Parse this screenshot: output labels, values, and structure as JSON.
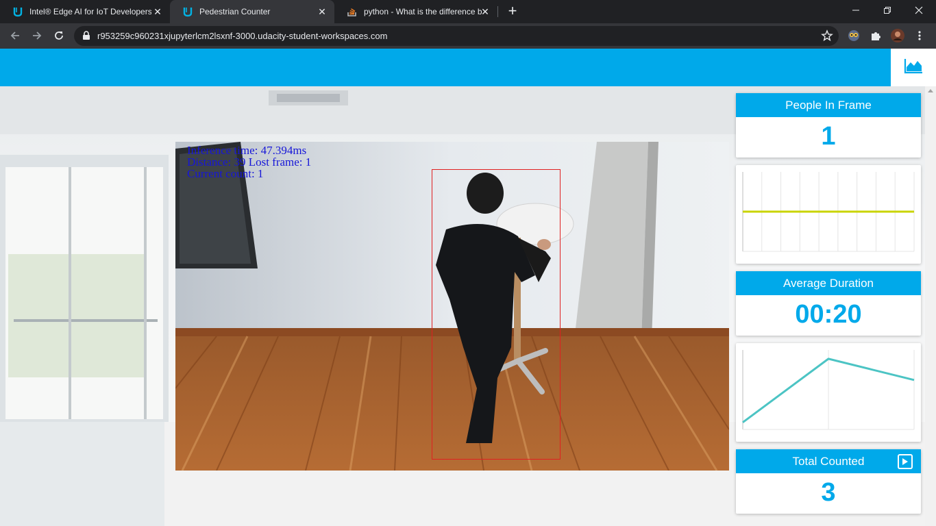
{
  "browser": {
    "tabs": [
      {
        "title": "Intel® Edge AI for IoT Developers",
        "icon": "udacity-icon",
        "active": false
      },
      {
        "title": "Pedestrian Counter",
        "icon": "udacity-icon",
        "active": true
      },
      {
        "title": "python - What is the difference b",
        "icon": "stackoverflow-icon",
        "active": false
      }
    ],
    "new_tab_label": "+",
    "url": "r953259c960231xjupyterlcm2lsxnf-3000.udacity-student-workspaces.com",
    "window_controls": [
      "minimize-icon",
      "restore-icon",
      "close-icon"
    ]
  },
  "app": {
    "accent_color": "#00a9ea",
    "header_icon": "area-chart-icon"
  },
  "video": {
    "overlay_lines": [
      "Inference time: 47.394ms",
      "Distance: 39 Lost frame: 1",
      "Current count: 1"
    ],
    "bbox_color": "#e02020"
  },
  "panels": {
    "people_in_frame": {
      "title": "People In Frame",
      "value": "1"
    },
    "average_duration": {
      "title": "Average Duration",
      "value": "00:20"
    },
    "total_counted": {
      "title": "Total Counted",
      "value": "3",
      "icon": "play-icon"
    }
  },
  "chart_data": [
    {
      "type": "line",
      "title": "",
      "series": [
        {
          "color": "#c9d400",
          "values": [
            1,
            1,
            1,
            1,
            1,
            1,
            1,
            1,
            1,
            1
          ]
        }
      ],
      "grid": "vertical",
      "ylim": [
        0,
        2
      ]
    },
    {
      "type": "line",
      "title": "",
      "x": [
        0,
        1,
        2
      ],
      "series": [
        {
          "color": "#4cc4c4",
          "values": [
            4,
            40,
            28
          ]
        }
      ],
      "grid": "vertical",
      "ylim": [
        0,
        45
      ]
    }
  ]
}
